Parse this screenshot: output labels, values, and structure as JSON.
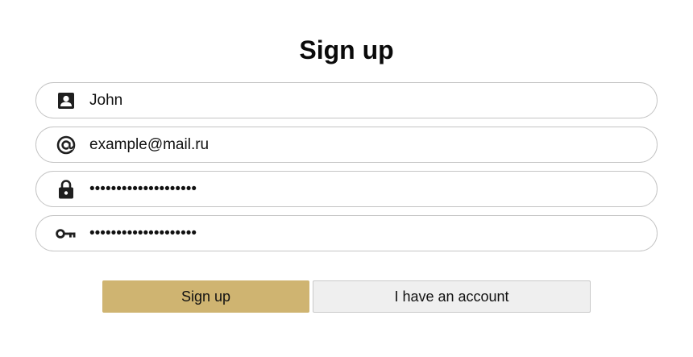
{
  "title": "Sign up",
  "form": {
    "name": {
      "value": "John",
      "icon": "contact-card-icon"
    },
    "email": {
      "value": "example@mail.ru",
      "icon": "at-sign-icon"
    },
    "password": {
      "value": "••••••••••••••••••••",
      "icon": "lock-icon"
    },
    "password_confirm": {
      "value": "••••••••••••••••••••",
      "icon": "key-icon"
    }
  },
  "buttons": {
    "signup_label": "Sign up",
    "account_label": "I have an account"
  },
  "colors": {
    "primary_button": "#cfb471",
    "secondary_button": "#efefef",
    "field_border": "#c4c4c4"
  }
}
